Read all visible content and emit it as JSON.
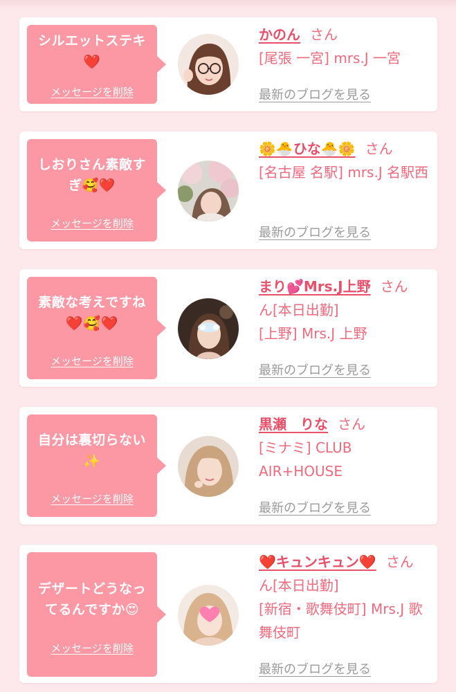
{
  "delete_label": "メッセージを削除",
  "blog_label": "最新のブログを見る",
  "san_label": "さん",
  "cards": [
    {
      "message": "シルエットステキ",
      "message_emoji": "❤️",
      "name": "かのん",
      "location": "[尾張 一宮] mrs.J 一宮"
    },
    {
      "message": "しおりさん素敵す",
      "message_line2": "ぎ",
      "message_emoji": "🥰❤️",
      "name": "🌼🐣ひな🐣🌼",
      "location": "[名古屋 名駅] mrs.J 名駅西"
    },
    {
      "message": "素敵な考えですね",
      "message_emoji": "❤️🥰❤️",
      "name": "まり💕Mrs.J上野",
      "san_suffix": "ん[本日出勤]",
      "location": "[上野] Mrs.J 上野"
    },
    {
      "message": "自分は裏切らない",
      "message_emoji": "✨",
      "name": "黒瀬　りな",
      "location": "[ミナミ] CLUB AIR+HOUSE"
    },
    {
      "message": "デザートどうなっ",
      "message_line2": "てるんですか",
      "message_emoji": "😍",
      "name": "❤️キュンキュン❤️",
      "san_suffix": "ん[本日出勤]",
      "location": "[新宿・歌舞伎町] Mrs.J 歌舞伎町"
    }
  ]
}
